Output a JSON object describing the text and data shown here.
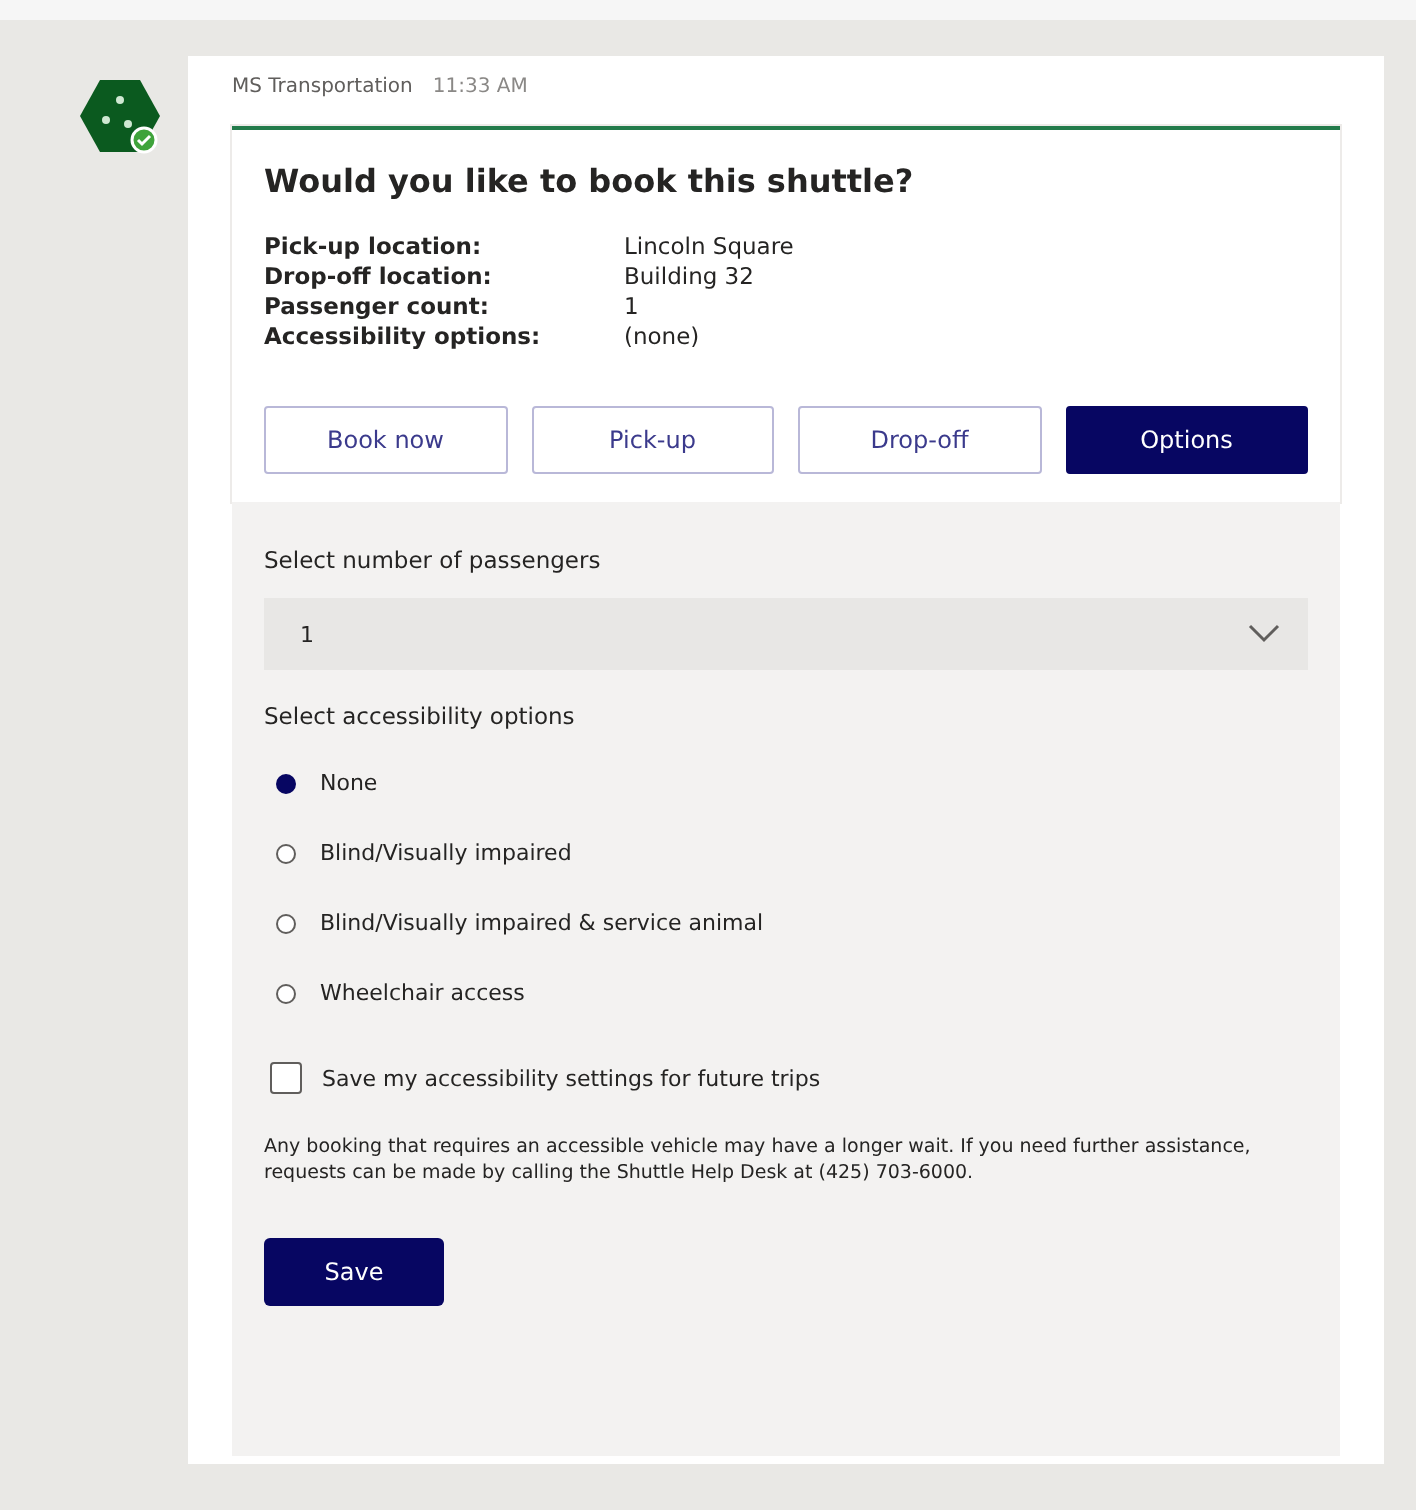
{
  "message": {
    "sender": "MS Transportation",
    "time": "11:33 AM"
  },
  "card": {
    "title": "Would you like to book this shuttle?",
    "facts": [
      {
        "label": "Pick-up location:",
        "value": "Lincoln Square"
      },
      {
        "label": "Drop-off location:",
        "value": "Building 32"
      },
      {
        "label": "Passenger count:",
        "value": "1"
      },
      {
        "label": "Accessibility options:",
        "value": "(none)"
      }
    ],
    "actions": [
      {
        "label": "Book now",
        "selected": false
      },
      {
        "label": "Pick-up",
        "selected": false
      },
      {
        "label": "Drop-off",
        "selected": false
      },
      {
        "label": "Options",
        "selected": true
      }
    ]
  },
  "options_panel": {
    "passengers_label": "Select number of passengers",
    "passengers_value": "1",
    "accessibility_label": "Select accessibility options",
    "choices": [
      {
        "label": "None",
        "selected": true
      },
      {
        "label": "Blind/Visually impaired",
        "selected": false
      },
      {
        "label": "Blind/Visually impaired & service animal",
        "selected": false
      },
      {
        "label": "Wheelchair access",
        "selected": false
      }
    ],
    "save_settings": {
      "label": "Save my accessibility settings for future trips",
      "checked": false
    },
    "note": "Any booking that requires an accessible vehicle may have a longer wait. If you need further assistance, requests can be made by calling the Shuttle Help Desk at (425) 703-6000.",
    "save_button": "Save"
  }
}
